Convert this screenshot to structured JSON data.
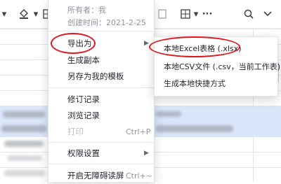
{
  "toolbar": {
    "icons": [
      "paint-bucket-icon",
      "table-grid-icon",
      "border-icon",
      "freeze-grid-icon",
      "more-icon",
      "search-icon",
      "chevron-down-icon"
    ],
    "more_glyph": "···",
    "search_glyph": "⚲",
    "chevron_glyph": "⌄",
    "caret_glyph": "▾"
  },
  "menu": {
    "owner": "所有者：我",
    "created": "创建时间：2021-2-25",
    "items": [
      {
        "label": "导出为",
        "has_submenu": true
      },
      {
        "label": "生成副本"
      },
      {
        "label": "另存为我的模板"
      },
      {
        "label": "修订记录"
      },
      {
        "label": "浏览记录"
      },
      {
        "label": "打印",
        "shortcut": "Ctrl+P",
        "disabled": true
      },
      {
        "label": "权限设置",
        "has_submenu": true
      },
      {
        "label": "开启无障碍读屏",
        "shortcut": "Ctrl+~"
      }
    ],
    "arrow_glyph": "▶"
  },
  "submenu": {
    "items": [
      {
        "label": "本地Excel表格 (.xlsx)"
      },
      {
        "label": "本地CSV文件 (.csv，当前工作表)"
      },
      {
        "label": "生成本地快捷方式"
      }
    ]
  },
  "annotation_color": "#e3161c",
  "selection_color": "#dbe6fb"
}
